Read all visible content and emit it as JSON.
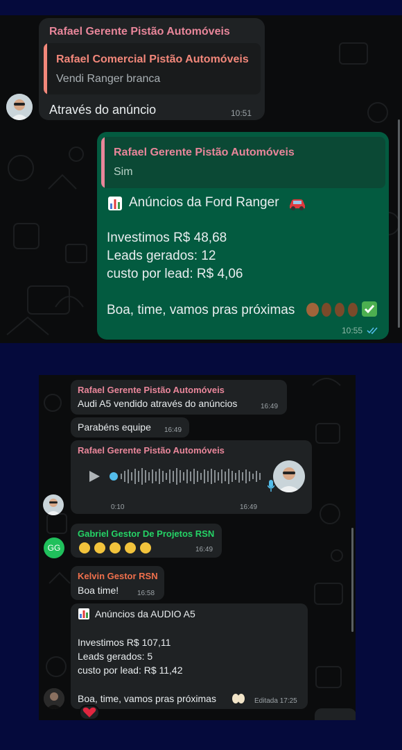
{
  "top": {
    "m1": {
      "sender": "Rafael Gerente Pistão Automóveis",
      "quote_sender": "Rafael Comercial Pistão Automóveis",
      "quote_text": "Vendi Ranger branca",
      "text": "Através do anúncio",
      "time": "10:51"
    },
    "m2": {
      "quote_sender": "Rafael Gerente Pistão Automóveis",
      "quote_text": "Sim",
      "line1": "Anúncios da Ford Ranger",
      "line2": "Investimos R$ 48,68",
      "line3": "Leads gerados: 12",
      "line4": "custo por lead: R$ 4,06",
      "line5": "Boa, time, vamos pras próximas",
      "time": "10:55"
    }
  },
  "bottom": {
    "m1": {
      "sender": "Rafael Gerente Pistão Automóveis",
      "text": "Audi A5 vendido através do anúncios",
      "time": "16:49"
    },
    "m2": {
      "text": "Parabéns equipe",
      "time": "16:49"
    },
    "m3": {
      "sender": "Rafael Gerente Pistão Automóveis",
      "duration": "0:10",
      "time": "16:49"
    },
    "m4": {
      "sender": "Gabriel Gestor De Projetos RSN",
      "avatar_initials": "GG",
      "time": "16:49"
    },
    "m5": {
      "sender": "Kelvin Gestor RSN",
      "text": "Boa time!",
      "time": "16:58"
    },
    "m6": {
      "line1": "Anúncios da AUDIO A5",
      "line2": "Investimos R$ 107,11",
      "line3": "Leads gerados: 5",
      "line4": "custo por lead: R$ 11,42",
      "line5": "Boa, time, vamos pras próximas",
      "time_label": "Editada 17:25"
    }
  },
  "colors": {
    "frame": "#050a3c",
    "chat_bg": "#0b0c0d",
    "incoming": "#1f2224",
    "outgoing": "#035b40",
    "name_rafael": "#e8869a",
    "name_comercial": "#f2877a",
    "name_gabriel": "#25d366",
    "name_kelvin": "#f0704c"
  }
}
